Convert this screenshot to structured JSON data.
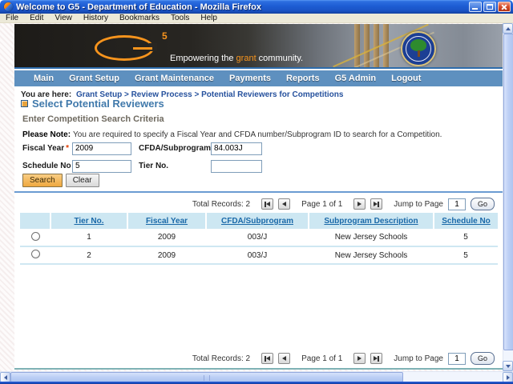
{
  "window": {
    "title": "Welcome to G5 - Department of Education - Mozilla Firefox"
  },
  "menubar": {
    "items": [
      "File",
      "Edit",
      "View",
      "History",
      "Bookmarks",
      "Tools",
      "Help"
    ]
  },
  "banner": {
    "logo_number": "5",
    "tagline_pre": "Empowering the ",
    "tagline_highlight": "grant",
    "tagline_post": " community."
  },
  "navbar": {
    "items": [
      "Main",
      "Grant Setup",
      "Grant Maintenance",
      "Payments",
      "Reports",
      "G5 Admin",
      "Logout"
    ]
  },
  "breadcrumb": {
    "prefix": "You are here:",
    "path": "Grant Setup > Review Process > Potential Reviewers for Competitions"
  },
  "page": {
    "heading": "Select Potential Reviewers",
    "section_title": "Enter Competition Search Criteria",
    "note_label": "Please Note:",
    "note_text": "You are required to specify a Fiscal Year and CFDA number/Subprogram ID to search for a Competition."
  },
  "form": {
    "required_marker": "*",
    "fields": [
      {
        "label": "Fiscal Year",
        "value": "2009"
      },
      {
        "label": "CFDA/Subprogram",
        "value": "84.003J"
      },
      {
        "label": "Schedule No",
        "value": "5"
      },
      {
        "label": "Tier No.",
        "value": ""
      }
    ],
    "search_label": "Search",
    "clear_label": "Clear"
  },
  "pagination": {
    "total_label": "Total Records:",
    "total_value": "2",
    "page_label": "Page 1 of 1",
    "jump_label": "Jump to Page",
    "jump_value": "1",
    "go_label": "Go"
  },
  "table": {
    "headers": [
      "Tier No.",
      "Fiscal Year",
      "CFDA/Subprogram",
      "Subprogram Description",
      "Schedule No"
    ],
    "rows": [
      {
        "tier": "1",
        "fiscal_year": "2009",
        "cfda": "003/J",
        "description": "New Jersey Schools",
        "schedule": "5"
      },
      {
        "tier": "2",
        "fiscal_year": "2009",
        "cfda": "003/J",
        "description": "New Jersey Schools",
        "schedule": "5"
      }
    ]
  },
  "colors": {
    "accent_orange": "#f7941d",
    "nav_blue": "#5e90bf",
    "link_blue": "#1968a8",
    "table_header_bg": "#cde7f2",
    "titlebar_blue": "#1d5cd3",
    "search_button_orange": "#efa83f",
    "required_red": "#e03c00",
    "divider_blue": "#6b9bd2"
  }
}
